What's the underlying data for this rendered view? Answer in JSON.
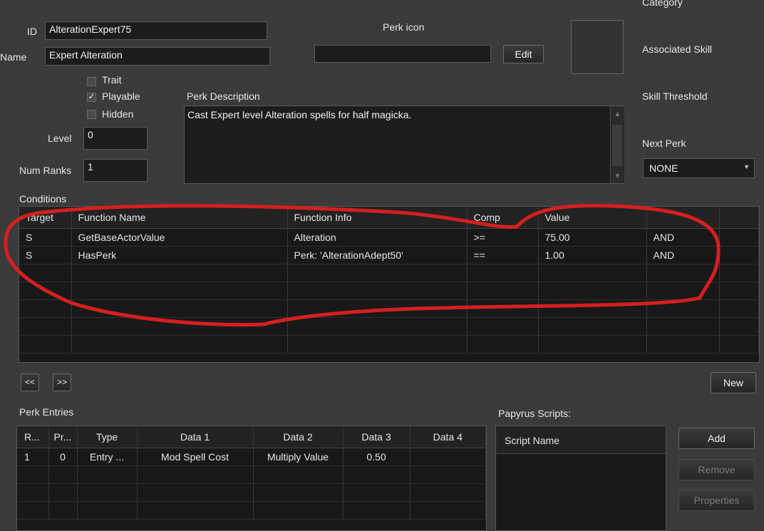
{
  "form": {
    "id_label": "ID",
    "id_value": "AlterationExpert75",
    "name_label": "Name",
    "name_value": "Expert Alteration",
    "trait_label": "Trait",
    "playable_label": "Playable",
    "hidden_label": "Hidden",
    "level_label": "Level",
    "level_value": "0",
    "num_ranks_label": "Num Ranks",
    "num_ranks_value": "1",
    "perk_icon_label": "Perk icon",
    "perk_icon_value": "",
    "edit_label": "Edit",
    "perk_description_label": "Perk Description",
    "perk_description_value": "Cast Expert level Alteration spells for half magicka.",
    "category_label": "Category",
    "associated_skill_label": "Associated Skill",
    "skill_threshold_label": "Skill Threshold",
    "next_perk_label": "Next Perk",
    "next_perk_value": "NONE"
  },
  "conditions": {
    "label": "Conditions",
    "columns": [
      "Target",
      "Function Name",
      "Function Info",
      "Comp",
      "Value",
      ""
    ],
    "rows": [
      [
        "S",
        "GetBaseActorValue",
        "Alteration",
        ">=",
        "75.00",
        "AND"
      ],
      [
        "S",
        "HasPerk",
        "Perk: 'AlterationAdept50'",
        "==",
        "1.00",
        "AND"
      ]
    ],
    "prev_label": "<<",
    "next_label": ">>",
    "new_label": "New"
  },
  "perk_entries": {
    "label": "Perk Entries",
    "columns": [
      "R...",
      "Pr...",
      "Type",
      "Data 1",
      "Data 2",
      "Data 3",
      "Data 4"
    ],
    "rows": [
      [
        "1",
        "0",
        "Entry ...",
        "Mod Spell Cost",
        "Multiply Value",
        "0.50",
        ""
      ]
    ]
  },
  "papyrus": {
    "label": "Papyrus Scripts:",
    "column": "Script Name",
    "add_label": "Add",
    "remove_label": "Remove",
    "properties_label": "Properties"
  },
  "colors": {
    "background": "#3a3a3a",
    "field": "#1c1c1c",
    "annotation": "#d41f1f"
  }
}
